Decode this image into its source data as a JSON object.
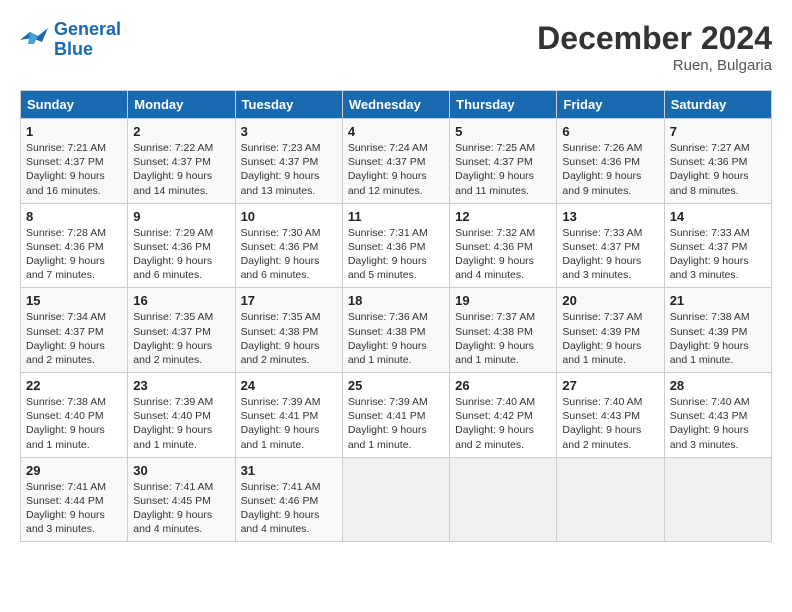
{
  "header": {
    "logo_line1": "General",
    "logo_line2": "Blue",
    "month": "December 2024",
    "location": "Ruen, Bulgaria"
  },
  "weekdays": [
    "Sunday",
    "Monday",
    "Tuesday",
    "Wednesday",
    "Thursday",
    "Friday",
    "Saturday"
  ],
  "weeks": [
    [
      {
        "day": 1,
        "info": "Sunrise: 7:21 AM\nSunset: 4:37 PM\nDaylight: 9 hours\nand 16 minutes."
      },
      {
        "day": 2,
        "info": "Sunrise: 7:22 AM\nSunset: 4:37 PM\nDaylight: 9 hours\nand 14 minutes."
      },
      {
        "day": 3,
        "info": "Sunrise: 7:23 AM\nSunset: 4:37 PM\nDaylight: 9 hours\nand 13 minutes."
      },
      {
        "day": 4,
        "info": "Sunrise: 7:24 AM\nSunset: 4:37 PM\nDaylight: 9 hours\nand 12 minutes."
      },
      {
        "day": 5,
        "info": "Sunrise: 7:25 AM\nSunset: 4:37 PM\nDaylight: 9 hours\nand 11 minutes."
      },
      {
        "day": 6,
        "info": "Sunrise: 7:26 AM\nSunset: 4:36 PM\nDaylight: 9 hours\nand 9 minutes."
      },
      {
        "day": 7,
        "info": "Sunrise: 7:27 AM\nSunset: 4:36 PM\nDaylight: 9 hours\nand 8 minutes."
      }
    ],
    [
      {
        "day": 8,
        "info": "Sunrise: 7:28 AM\nSunset: 4:36 PM\nDaylight: 9 hours\nand 7 minutes."
      },
      {
        "day": 9,
        "info": "Sunrise: 7:29 AM\nSunset: 4:36 PM\nDaylight: 9 hours\nand 6 minutes."
      },
      {
        "day": 10,
        "info": "Sunrise: 7:30 AM\nSunset: 4:36 PM\nDaylight: 9 hours\nand 6 minutes."
      },
      {
        "day": 11,
        "info": "Sunrise: 7:31 AM\nSunset: 4:36 PM\nDaylight: 9 hours\nand 5 minutes."
      },
      {
        "day": 12,
        "info": "Sunrise: 7:32 AM\nSunset: 4:36 PM\nDaylight: 9 hours\nand 4 minutes."
      },
      {
        "day": 13,
        "info": "Sunrise: 7:33 AM\nSunset: 4:37 PM\nDaylight: 9 hours\nand 3 minutes."
      },
      {
        "day": 14,
        "info": "Sunrise: 7:33 AM\nSunset: 4:37 PM\nDaylight: 9 hours\nand 3 minutes."
      }
    ],
    [
      {
        "day": 15,
        "info": "Sunrise: 7:34 AM\nSunset: 4:37 PM\nDaylight: 9 hours\nand 2 minutes."
      },
      {
        "day": 16,
        "info": "Sunrise: 7:35 AM\nSunset: 4:37 PM\nDaylight: 9 hours\nand 2 minutes."
      },
      {
        "day": 17,
        "info": "Sunrise: 7:35 AM\nSunset: 4:38 PM\nDaylight: 9 hours\nand 2 minutes."
      },
      {
        "day": 18,
        "info": "Sunrise: 7:36 AM\nSunset: 4:38 PM\nDaylight: 9 hours\nand 1 minute."
      },
      {
        "day": 19,
        "info": "Sunrise: 7:37 AM\nSunset: 4:38 PM\nDaylight: 9 hours\nand 1 minute."
      },
      {
        "day": 20,
        "info": "Sunrise: 7:37 AM\nSunset: 4:39 PM\nDaylight: 9 hours\nand 1 minute."
      },
      {
        "day": 21,
        "info": "Sunrise: 7:38 AM\nSunset: 4:39 PM\nDaylight: 9 hours\nand 1 minute."
      }
    ],
    [
      {
        "day": 22,
        "info": "Sunrise: 7:38 AM\nSunset: 4:40 PM\nDaylight: 9 hours\nand 1 minute."
      },
      {
        "day": 23,
        "info": "Sunrise: 7:39 AM\nSunset: 4:40 PM\nDaylight: 9 hours\nand 1 minute."
      },
      {
        "day": 24,
        "info": "Sunrise: 7:39 AM\nSunset: 4:41 PM\nDaylight: 9 hours\nand 1 minute."
      },
      {
        "day": 25,
        "info": "Sunrise: 7:39 AM\nSunset: 4:41 PM\nDaylight: 9 hours\nand 1 minute."
      },
      {
        "day": 26,
        "info": "Sunrise: 7:40 AM\nSunset: 4:42 PM\nDaylight: 9 hours\nand 2 minutes."
      },
      {
        "day": 27,
        "info": "Sunrise: 7:40 AM\nSunset: 4:43 PM\nDaylight: 9 hours\nand 2 minutes."
      },
      {
        "day": 28,
        "info": "Sunrise: 7:40 AM\nSunset: 4:43 PM\nDaylight: 9 hours\nand 3 minutes."
      }
    ],
    [
      {
        "day": 29,
        "info": "Sunrise: 7:41 AM\nSunset: 4:44 PM\nDaylight: 9 hours\nand 3 minutes."
      },
      {
        "day": 30,
        "info": "Sunrise: 7:41 AM\nSunset: 4:45 PM\nDaylight: 9 hours\nand 4 minutes."
      },
      {
        "day": 31,
        "info": "Sunrise: 7:41 AM\nSunset: 4:46 PM\nDaylight: 9 hours\nand 4 minutes."
      },
      null,
      null,
      null,
      null
    ]
  ]
}
